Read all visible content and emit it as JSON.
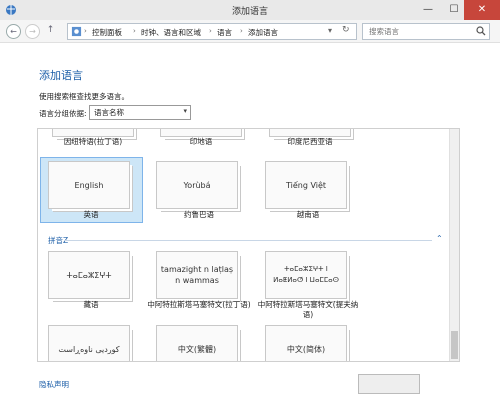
{
  "window": {
    "title": "添加语言",
    "min": "—",
    "max": "☐",
    "close": "✕"
  },
  "nav": {
    "back": "←",
    "forward": "→",
    "up": "↑",
    "breadcrumb": [
      "控制面板",
      "时钟、语言和区域",
      "语言",
      "添加语言"
    ],
    "sep": "›",
    "refresh": "↻",
    "dropdown": "▾",
    "search_placeholder": "搜索语言"
  },
  "page": {
    "heading": "添加语言",
    "hint": "使用搜索框查找更多语言。",
    "group_label": "语言分组依据:",
    "group_value": "语言名称"
  },
  "partial_row": [
    "因纽特语(拉丁语)",
    "印地语",
    "印度尼西亚语"
  ],
  "row1": [
    {
      "native": "English",
      "label": "英语"
    },
    {
      "native": "Yorùbá",
      "label": "约鲁巴语"
    },
    {
      "native": "Tiếng Việt",
      "label": "越南语"
    }
  ],
  "section": {
    "title": "拼音Z",
    "caret": "⌃"
  },
  "row2": [
    {
      "native": "ⵜⴰⵎⴰⵣⵉⵖⵜ",
      "label": "藏语"
    },
    {
      "native": "tamazight n laṭlaṣ n wammas",
      "label": "中阿特拉斯塔马塞特文(拉丁语)"
    },
    {
      "native": "ⵜⴰⵎⴰⵣⵉⵖⵜ ⵏ ⵍⴰⵟⵍⴰⵚ ⵏ ⵡⴰⵎⵎⴰⵙ",
      "label": "中阿特拉斯塔马塞特文(提夫纳语)"
    }
  ],
  "row3": [
    {
      "native": "کوردیی ناوەڕاست"
    },
    {
      "native": "中文(繁體)"
    },
    {
      "native": "中文(简体)"
    }
  ],
  "footer": {
    "privacy": "隐私声明"
  }
}
